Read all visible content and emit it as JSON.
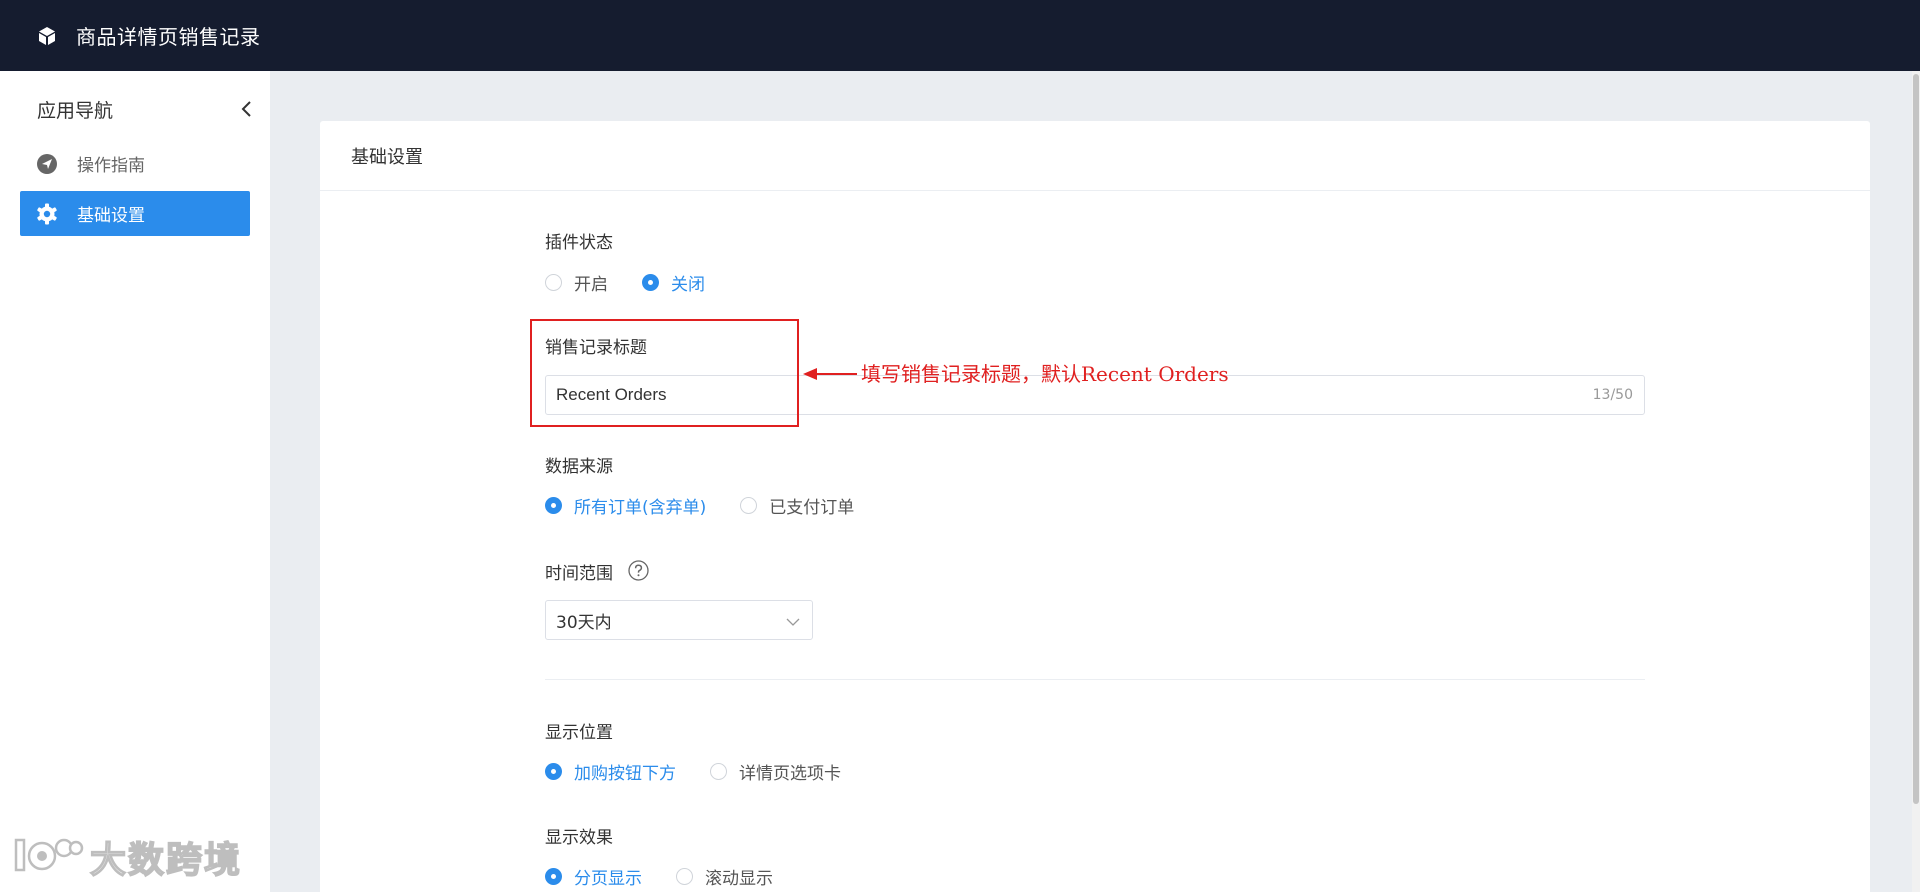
{
  "header": {
    "title": "商品详情页销售记录",
    "logo_icon": "cube-icon"
  },
  "sidebar": {
    "title": "应用导航",
    "items": [
      {
        "label": "操作指南",
        "icon": "navigation-arrow-icon",
        "active": false
      },
      {
        "label": "基础设置",
        "icon": "gear-icon",
        "active": true
      }
    ]
  },
  "card": {
    "title": "基础设置",
    "plugin_status": {
      "label": "插件状态",
      "options": [
        "开启",
        "关闭"
      ],
      "selected": "关闭"
    },
    "sales_title": {
      "label": "销售记录标题",
      "value": "Recent Orders",
      "counter": "13/50"
    },
    "data_source": {
      "label": "数据来源",
      "options": [
        "所有订单(含弃单)",
        "已支付订单"
      ],
      "selected": "所有订单(含弃单)"
    },
    "time_range": {
      "label": "时间范围",
      "value": "30天内"
    },
    "display_position": {
      "label": "显示位置",
      "options": [
        "加购按钮下方",
        "详情页选项卡"
      ],
      "selected": "加购按钮下方"
    },
    "display_effect": {
      "label": "显示效果",
      "options": [
        "分页显示",
        "滚动显示"
      ],
      "selected": "分页显示"
    }
  },
  "annotation": {
    "text": "填写销售记录标题，默认Recent Orders"
  },
  "watermark": {
    "text": "大数跨境"
  },
  "colors": {
    "topbar": "#151c2f",
    "accent": "#2b8ceb",
    "annotation": "#e02020",
    "background": "#eaedf1"
  }
}
